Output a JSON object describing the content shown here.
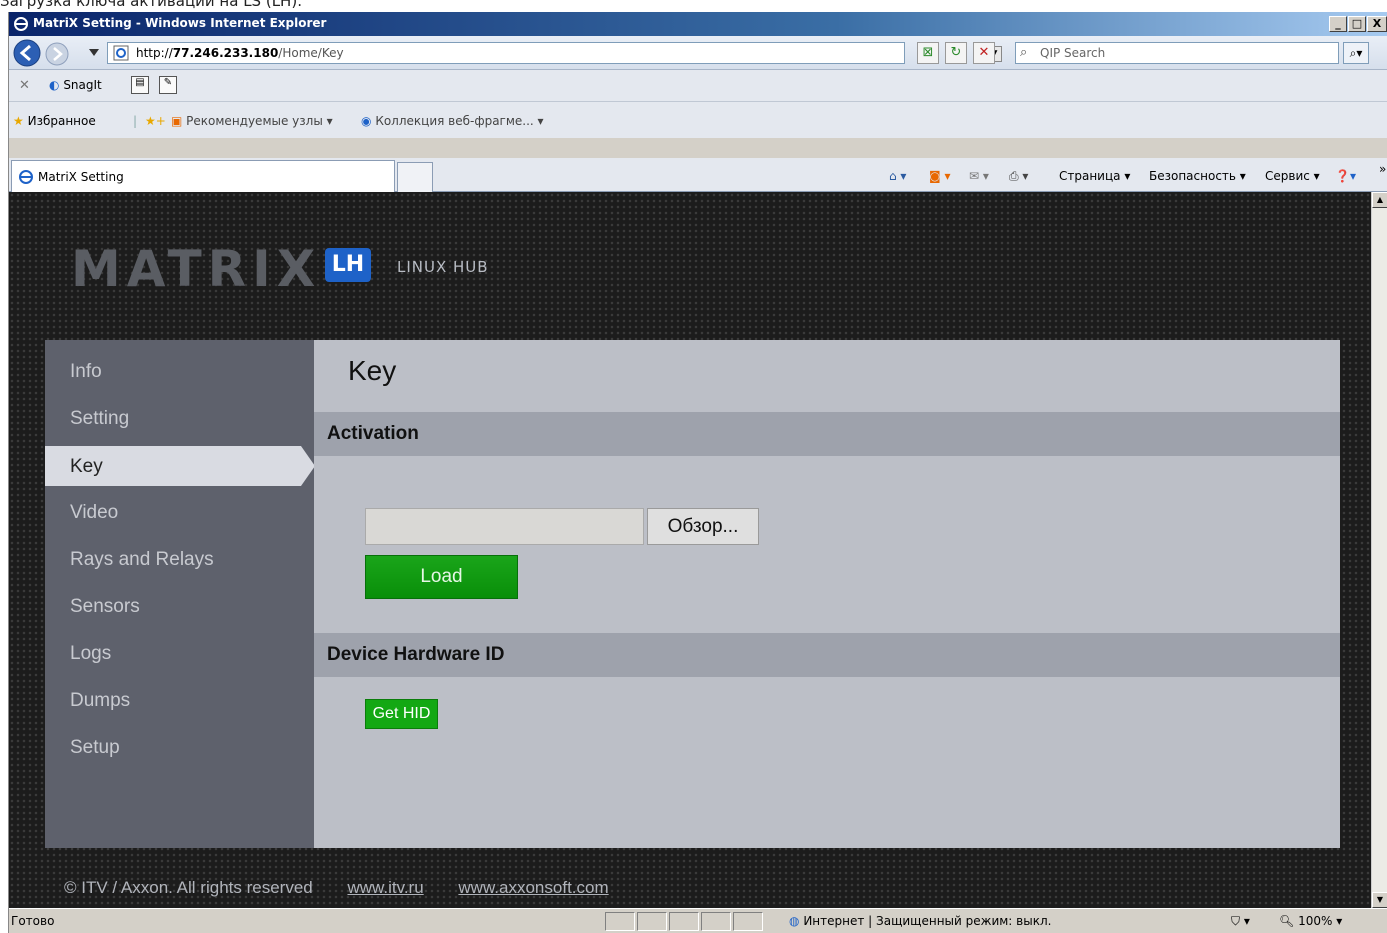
{
  "caption": "Загрузка ключа активации на LS (LH):",
  "window": {
    "title": "MatriX Setting - Windows Internet Explorer",
    "min_label": "_",
    "max_label": "□",
    "close_label": "X"
  },
  "address": {
    "scheme": "http://",
    "host": "77.246.233.180",
    "path": "/Home/Key"
  },
  "search": {
    "placeholder": "QIP Search"
  },
  "toolbar": {
    "snagit_label": "SnagIt"
  },
  "favorites": {
    "label": "Избранное",
    "suggested_sites": "Рекомендуемые узлы ▾",
    "web_slices": "Коллекция веб-фрагме...  ▾"
  },
  "tab": {
    "label": "MatriX Setting"
  },
  "commands": {
    "page": "Страница ▾",
    "safety": "Безопасность ▾",
    "service": "Сервис ▾"
  },
  "page": {
    "logo": "MATRIX",
    "logo_badge": "LH",
    "logo_subtitle": "LINUX HUB",
    "nav": [
      {
        "label": "Info"
      },
      {
        "label": "Setting"
      },
      {
        "label": "Key"
      },
      {
        "label": "Video"
      },
      {
        "label": "Rays and Relays"
      },
      {
        "label": "Sensors"
      },
      {
        "label": "Logs"
      },
      {
        "label": "Dumps"
      },
      {
        "label": "Setup"
      }
    ],
    "active_nav": "Key",
    "heading": "Key",
    "activation_title": "Activation",
    "browse_label": "Обзор...",
    "load_label": "Load",
    "hid_title": "Device Hardware ID",
    "get_hid_label": "Get HID",
    "footer": {
      "copyright": "© ITV / Axxon. All rights reserved",
      "link1": "www.itv.ru",
      "link2": "www.axxonsoft.com"
    }
  },
  "status": {
    "text": "Готово",
    "zone": "Интернет | Защищенный режим: выкл.",
    "zoom": "100%"
  },
  "colors": {
    "sidebar": "#5e616c",
    "content": "#bcbfc7",
    "section_bar": "#9ea2ac",
    "accent_green": "#0f9e0f",
    "logo_badge": "#1e62c8"
  }
}
